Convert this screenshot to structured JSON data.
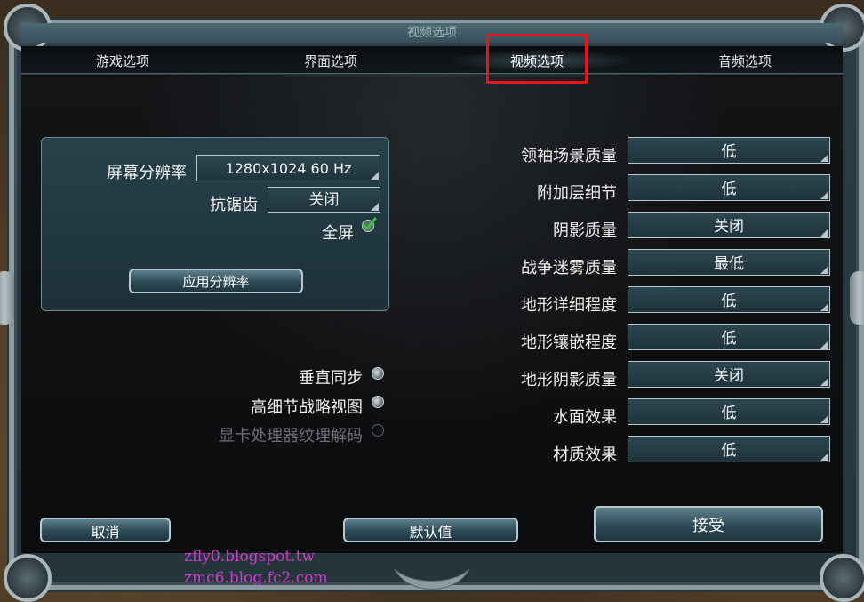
{
  "window": {
    "title": "视频选项"
  },
  "tabs": [
    {
      "label": "游戏选项"
    },
    {
      "label": "界面选项"
    },
    {
      "label": "视频选项"
    },
    {
      "label": "音频选项"
    }
  ],
  "display_panel": {
    "resolution_label": "屏幕分辨率",
    "resolution_value": "1280x1024   60 Hz",
    "antialias_label": "抗锯齿",
    "antialias_value": "关闭",
    "fullscreen_label": "全屏",
    "apply_button": "应用分辨率"
  },
  "toggles": [
    {
      "label": "垂直同步",
      "state": "on"
    },
    {
      "label": "高细节战略视图",
      "state": "on"
    },
    {
      "label": "显卡处理器纹理解码",
      "state": "disabled"
    }
  ],
  "quality_settings": [
    {
      "label": "领袖场景质量",
      "value": "低"
    },
    {
      "label": "附加层细节",
      "value": "低"
    },
    {
      "label": "阴影质量",
      "value": "关闭"
    },
    {
      "label": "战争迷雾质量",
      "value": "最低"
    },
    {
      "label": "地形详细程度",
      "value": "低"
    },
    {
      "label": "地形镶嵌程度",
      "value": "低"
    },
    {
      "label": "地形阴影质量",
      "value": "关闭"
    },
    {
      "label": "水面效果",
      "value": "低"
    },
    {
      "label": "材质效果",
      "value": "低"
    }
  ],
  "footer": {
    "cancel_button": "取消",
    "default_button": "默认值",
    "accept_button": "接受"
  },
  "watermark": {
    "line1": "zfly0.blogspot.tw",
    "line2": "zmc6.blog.fc2.com"
  },
  "colors": {
    "highlight_box": "#e8141b",
    "watermark": "#d03bd0",
    "check": "#3fbf3f"
  }
}
